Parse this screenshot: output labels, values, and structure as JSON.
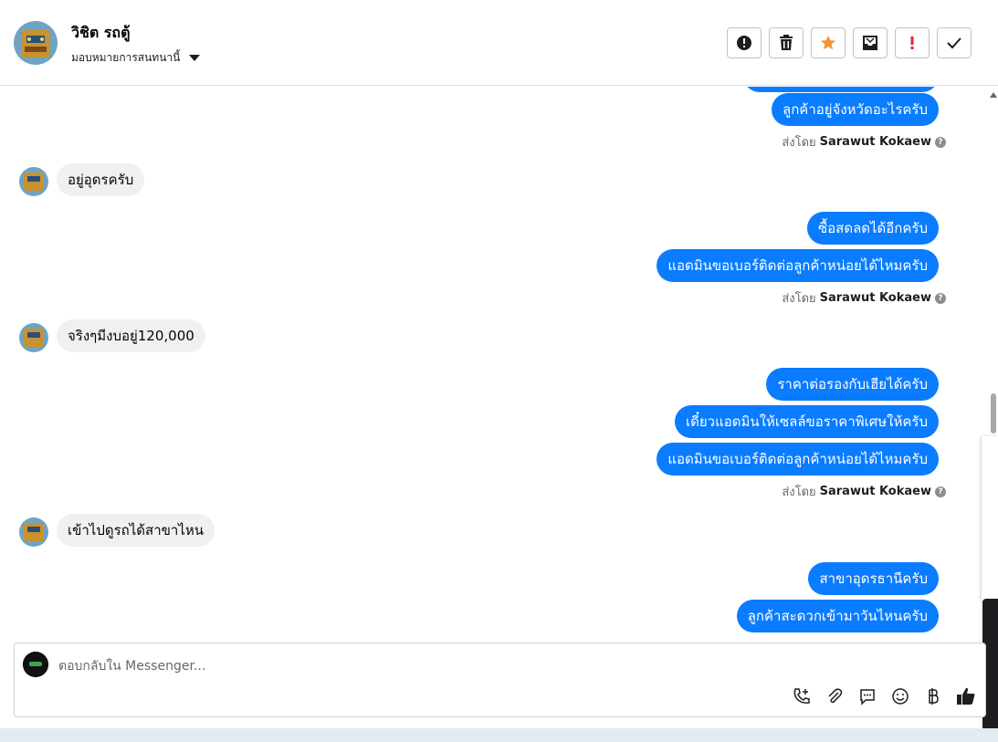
{
  "header": {
    "contact_name": "วิชิต รถตู้",
    "assign_label": "มอบหมายการสนทนานี้",
    "toolbar": [
      {
        "name": "report-icon"
      },
      {
        "name": "trash-icon"
      },
      {
        "name": "star-icon",
        "color": "#f7923b"
      },
      {
        "name": "move-to-inbox-icon"
      },
      {
        "name": "mark-important-icon",
        "color": "#e41e3f"
      },
      {
        "name": "checkmark-icon"
      }
    ]
  },
  "messages": [
    {
      "dir": "out",
      "text": "ลูกค้าอยู่จังหวัดอะไรครับ"
    },
    {
      "dir": "sent_by",
      "prefix": "ส่งโดย",
      "name": "Sarawut Kokaew"
    },
    {
      "dir": "in",
      "text": "อยู่อุดรครับ"
    },
    {
      "dir": "out",
      "text": "ซื้อสดลดได้อีกครับ"
    },
    {
      "dir": "out",
      "text": "แอดมินขอเบอร์ติดต่อลูกค้าหน่อยได้ไหมครับ"
    },
    {
      "dir": "sent_by",
      "prefix": "ส่งโดย",
      "name": "Sarawut Kokaew"
    },
    {
      "dir": "in",
      "text": "จริงๆมีงบอยู่120,000"
    },
    {
      "dir": "out",
      "text": "ราคาต่อรองกับเฮียได้ครับ"
    },
    {
      "dir": "out",
      "text": "เดี๋ยวแอดมินให้เซลล์ขอราคาพิเศษให้ครับ"
    },
    {
      "dir": "out",
      "text": "แอดมินขอเบอร์ติดต่อลูกค้าหน่อยได้ไหมครับ"
    },
    {
      "dir": "sent_by",
      "prefix": "ส่งโดย",
      "name": "Sarawut Kokaew"
    },
    {
      "dir": "in",
      "text": "เข้าไปดูรถได้สาขาไหน"
    },
    {
      "dir": "out",
      "text": "สาขาอุดรธานีครับ"
    },
    {
      "dir": "out",
      "text": "ลูกค้าสะดวกเข้ามาวันไหนครับ"
    }
  ],
  "composer": {
    "placeholder": "ตอบกลับใน Messenger...",
    "tools": [
      "phone-add-icon",
      "paperclip-icon",
      "chat-bubble-icon",
      "emoji-icon",
      "baht-icon",
      "thumbs-up-icon"
    ]
  },
  "colors": {
    "outgoing_bubble": "#0a7cff",
    "incoming_bubble": "#f0f0f0"
  }
}
